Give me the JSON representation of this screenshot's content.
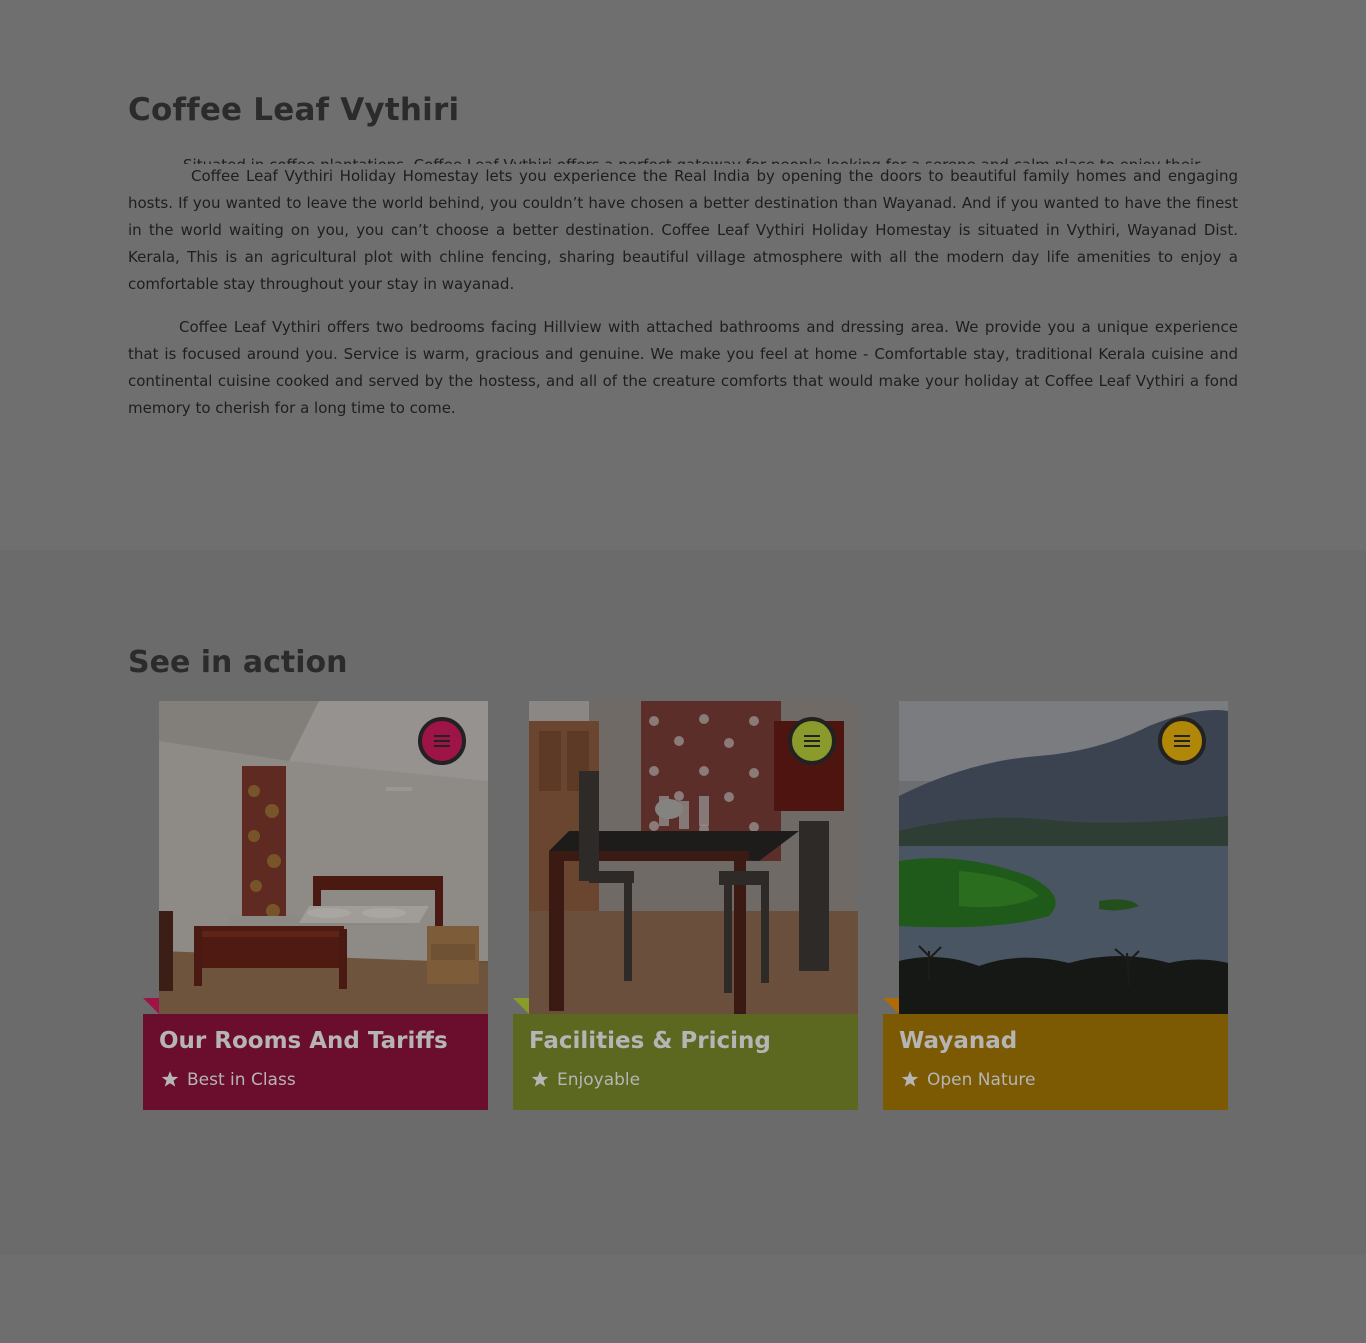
{
  "intro": {
    "title": "Coffee Leaf Vythiri",
    "overlap_text": "Situated in coffee plantations, Coffee Leaf Vythiri offers a perfect gateway for people looking for a serene and calm place to enjoy their",
    "paragraph1": "Coffee Leaf Vythiri Holiday Homestay lets you experience the Real India by opening the doors to beautiful family homes and engaging hosts. If you wanted to leave the world behind, you couldn’t have chosen a better destination than Wayanad. And if you wanted to have the finest in the world waiting on you, you can’t choose a better destination. Coffee Leaf Vythiri Holiday Homestay is situated in Vythiri, Wayanad Dist. Kerala, This is an agricultural plot with chline fencing, sharing beautiful village atmosphere with all the modern day life amenities to enjoy a comfortable stay throughout your stay in wayanad.",
    "paragraph2": "Coffee Leaf Vythiri offers two bedrooms facing Hillview with attached bathrooms and dressing area. We provide you a unique experience that is focused around you. Service is warm, gracious and genuine. We make you feel at home - Comfortable stay, traditional Kerala cuisine and continental cuisine cooked and served by the hostess, and all of the creature comforts that would make your holiday at Coffee Leaf Vythiri a fond memory to cherish for a long time to come."
  },
  "action": {
    "title": "See in action",
    "cards": [
      {
        "title": "Our Rooms And Tariffs",
        "subtitle": "Best in Class",
        "color": "#6b0d2d",
        "accent": "#9e1446",
        "icon": "star-icon"
      },
      {
        "title": "Facilities & Pricing",
        "subtitle": "Enjoyable",
        "color": "#5c681f",
        "accent": "#8a9a2b",
        "icon": "star-icon"
      },
      {
        "title": "Wayanad",
        "subtitle": "Open Nature",
        "color": "#7c5a04",
        "accent": "#b18708",
        "icon": "star-icon"
      }
    ]
  }
}
